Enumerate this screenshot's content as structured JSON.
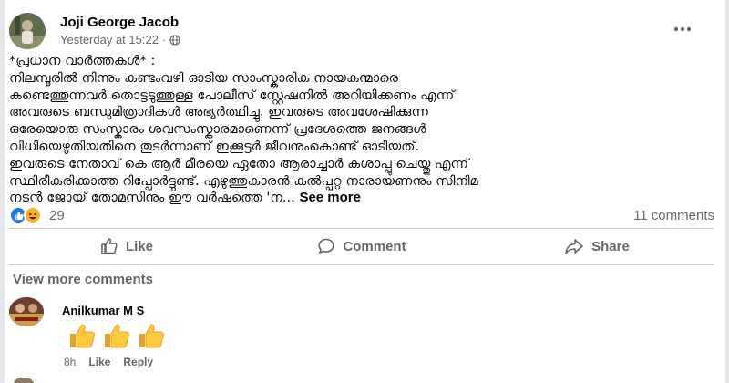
{
  "post": {
    "author": "Joji George Jacob",
    "timestamp": "Yesterday at 15:22",
    "separator": "·",
    "privacy_icon": "globe-icon",
    "more_icon": "more-horizontal-icon",
    "text": "*പ്രധാന വാർത്തകൾ* :\nനിലമ്പൂരിൽ നിന്നും കണ്ടംവഴി ഓടിയ സാംസ്കാരിക നായകന്മാരെ\nകണ്ടെത്തുന്നവർ തൊട്ടടുത്തുള്ള പോലീസ് സ്റ്റേഷനിൽ അറിയിക്കണം എന്ന്\nഅവരുടെ ബന്ധുമിത്രാദികൾ അഭ്യർത്ഥിച്ചു. ഇവരുടെ  അവശേഷിക്കുന്ന\nഒരേയൊരു സംസ്കാരം ശവസംസ്കാരമാണെന്ന് പ്രദേശത്തെ ജനങ്ങൾ\nവിധിയെഴുതിയതിനെ തുടർന്നാണ് ഇക്കൂട്ടർ ജീവനുംകൊണ്ട് ഓടിയത്.\nഇവരുടെ നേതാവ് കെ ആർ മീരയെ ഏതോ ആരാച്ചാർ കശാപ്പു ചെയ്തു എന്ന്\nസ്ഥിരീകരിക്കാത്ത റിപ്പോർട്ടുണ്ട്. എഴുത്തുകാരൻ കൽപ്പറ്റ നാരായണനും  സിനിമ\nനടൻ ജോയ് തോമസിനും ഈ വർഷത്തെ 'ന...",
    "see_more": "See more"
  },
  "stats": {
    "reaction_count": "29",
    "comment_count": "11 comments",
    "reaction_icons": [
      "like-reaction-icon",
      "haha-reaction-icon"
    ]
  },
  "actions": {
    "like": "Like",
    "comment": "Comment",
    "share": "Share"
  },
  "comments": {
    "view_more": "View more comments",
    "items": [
      {
        "author": "Anilkumar M S",
        "content_icons": [
          "thumbs-up-icon",
          "thumbs-up-icon",
          "thumbs-up-icon"
        ],
        "time": "8h",
        "like": "Like",
        "reply": "Reply"
      }
    ]
  },
  "colors": {
    "primary_text": "#050505",
    "secondary_text": "#65676b",
    "like_blue": "#1877f2",
    "haha_yellow": "#f7b125",
    "divider": "#ced0d4",
    "thumb_yellow": "#ffc83d"
  }
}
